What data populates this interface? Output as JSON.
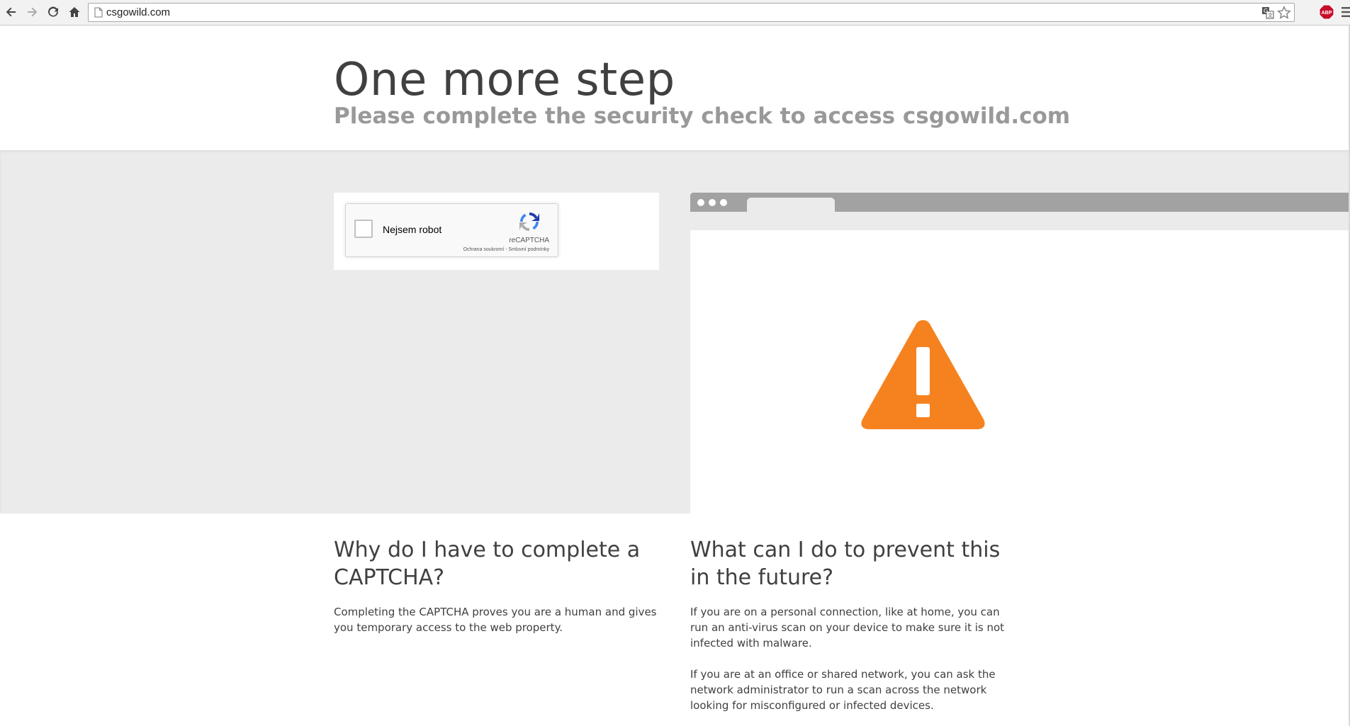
{
  "browser": {
    "url": "csgowild.com",
    "icons": {
      "back": "back-arrow-icon",
      "forward": "forward-arrow-icon",
      "reload": "reload-icon",
      "home": "home-icon",
      "page": "page-icon",
      "translate": "translate-icon",
      "star": "bookmark-star-icon",
      "abp": "adblock-plus-icon",
      "menu": "hamburger-menu-icon"
    },
    "abp_label": "ABP"
  },
  "header": {
    "title": "One more step",
    "subtitle": "Please complete the security check to access csgowild.com"
  },
  "captcha": {
    "checkbox_label": "Nejsem robot",
    "brand": "reCAPTCHA",
    "links": "Ochrana soukromí - Smluvní podmínky"
  },
  "colors": {
    "warning": "#f6821f",
    "band_bg": "#ebebeb",
    "mock_bar": "#a2a2a2"
  },
  "left_section": {
    "heading": "Why do I have to complete a CAPTCHA?",
    "body": "Completing the CAPTCHA proves you are a human and gives you temporary access to the web property."
  },
  "right_section": {
    "heading": "What can I do to prevent this in the future?",
    "body1": "If you are on a personal connection, like at home, you can run an anti-virus scan on your device to make sure it is not infected with malware.",
    "body2": "If you are at an office or shared network, you can ask the network administrator to run a scan across the network looking for misconfigured or infected devices."
  }
}
